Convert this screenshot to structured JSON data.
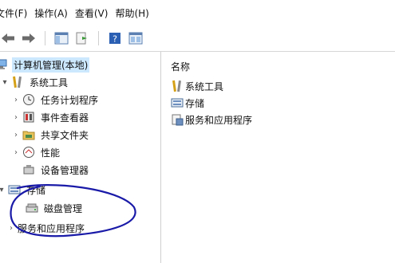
{
  "menubar": {
    "items": [
      {
        "label": "文件(F)"
      },
      {
        "label": "操作(A)"
      },
      {
        "label": "查看(V)"
      },
      {
        "label": "帮助(H)"
      }
    ]
  },
  "toolbar": {
    "buttons": [
      "back-icon",
      "forward-icon",
      "show-hide-tree-icon",
      "export-list-icon",
      "help-icon",
      "properties-icon"
    ]
  },
  "tree": {
    "root": {
      "label": "计算机管理(本地)"
    },
    "system_tools": {
      "label": "系统工具"
    },
    "children": [
      {
        "label": "任务计划程序"
      },
      {
        "label": "事件查看器"
      },
      {
        "label": "共享文件夹"
      },
      {
        "label": "性能"
      },
      {
        "label": "设备管理器"
      }
    ],
    "storage": {
      "label": "存储"
    },
    "disk_management": {
      "label": "磁盘管理"
    },
    "services": {
      "label": "服务和应用程序"
    }
  },
  "right_pane": {
    "column_header": "名称",
    "rows": [
      {
        "label": "系统工具"
      },
      {
        "label": "存储"
      },
      {
        "label": "服务和应用程序"
      }
    ]
  },
  "annotation": {
    "color": "#1a1aa8"
  }
}
